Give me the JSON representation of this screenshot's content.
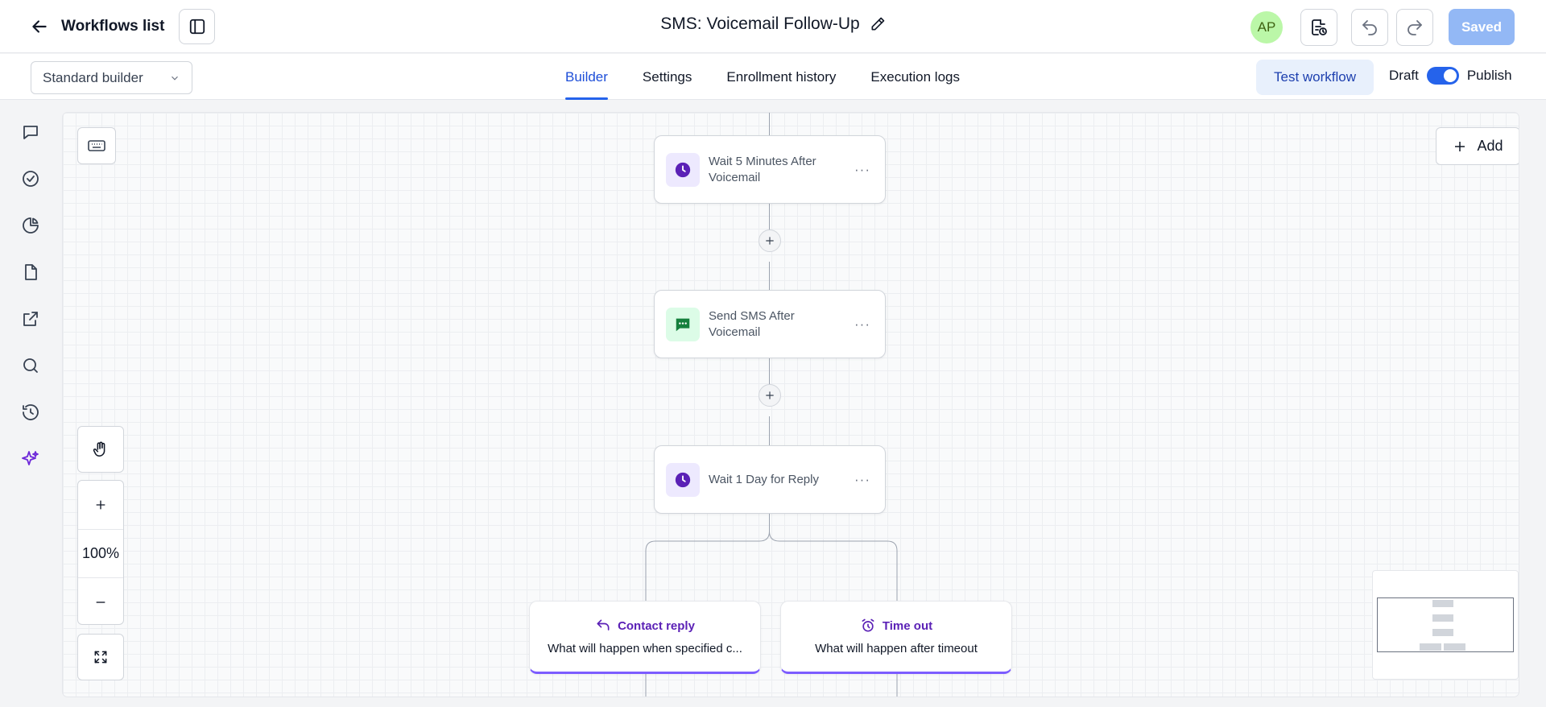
{
  "header": {
    "back_label": "Workflows list",
    "title": "SMS: Voicemail Follow-Up",
    "avatar_initials": "AP",
    "saved_label": "Saved"
  },
  "subbar": {
    "builder_select": "Standard builder",
    "tabs": [
      {
        "label": "Builder",
        "active": true
      },
      {
        "label": "Settings",
        "active": false
      },
      {
        "label": "Enrollment history",
        "active": false
      },
      {
        "label": "Execution logs",
        "active": false
      }
    ],
    "test_label": "Test workflow",
    "draft_label": "Draft",
    "publish_label": "Publish",
    "publish_on": true
  },
  "rail": {
    "icons": [
      "chat-icon",
      "check-circle-icon",
      "pie-chart-icon",
      "file-icon",
      "external-link-icon",
      "search-icon",
      "history-icon",
      "sparkles-icon"
    ]
  },
  "canvas": {
    "add_label": "Add",
    "zoom": "100%",
    "nodes": [
      {
        "label": "Wait 5 Minutes After Voicemail",
        "icon": "clock-icon"
      },
      {
        "label": "Send SMS After Voicemail",
        "icon": "message-icon"
      },
      {
        "label": "Wait 1 Day for Reply",
        "icon": "clock-icon"
      }
    ],
    "branches": [
      {
        "title": "Contact reply",
        "desc": "What will happen when specified c...",
        "icon": "reply-icon"
      },
      {
        "title": "Time out",
        "desc": "What will happen after timeout",
        "icon": "alarm-icon"
      }
    ]
  },
  "colors": {
    "accent": "#2563eb",
    "saved_bg": "#93b8f5",
    "wait_icon": "#5b21b6",
    "sms_icon": "#15803d",
    "branch_accent": "#7c5cff"
  }
}
